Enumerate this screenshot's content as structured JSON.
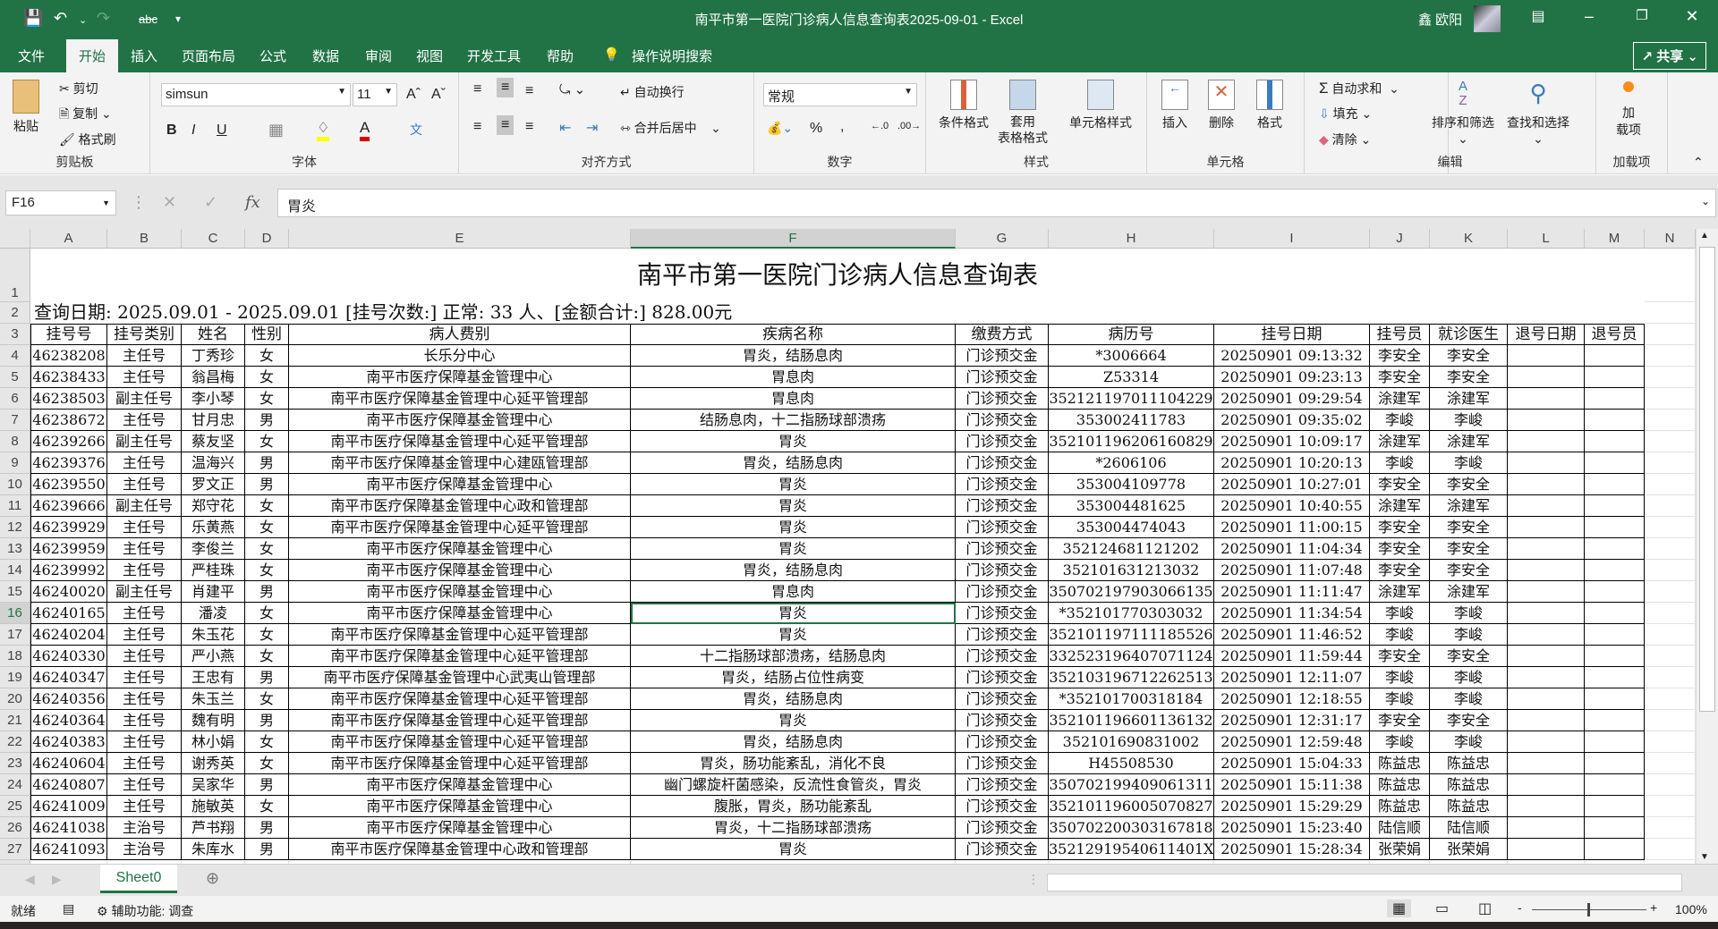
{
  "window": {
    "title": "南平市第一医院门诊病人信息查询表2025-09-01  -  Excel",
    "user": "鑫 欧阳"
  },
  "tabs": [
    "文件",
    "开始",
    "插入",
    "页面布局",
    "公式",
    "数据",
    "审阅",
    "视图",
    "开发工具",
    "帮助"
  ],
  "active_tab": "开始",
  "tell_me": "操作说明搜索",
  "share_label": "共享",
  "ribbon": {
    "clipboard": {
      "label": "剪贴板",
      "paste": "粘贴",
      "cut": "剪切",
      "copy": "复制",
      "format_painter": "格式刷"
    },
    "font": {
      "label": "字体",
      "font_name": "simsun",
      "font_size": "11",
      "bold": "B",
      "italic": "I",
      "underline": "U",
      "highlight_color": "#ffff00",
      "font_color": "#e00000"
    },
    "alignment": {
      "label": "对齐方式",
      "wrap": "自动换行",
      "merge": "合并后居中"
    },
    "number": {
      "label": "数字",
      "format": "常规",
      "percent": "%",
      "comma": ","
    },
    "styles": {
      "label": "样式",
      "conditional": "条件格式",
      "table_l1": "套用",
      "table_l2": "表格格式",
      "cell_styles": "单元格样式"
    },
    "cells": {
      "label": "单元格",
      "insert": "插入",
      "delete": "删除",
      "format": "格式"
    },
    "editing": {
      "label": "编辑",
      "autosum": "自动求和",
      "fill": "填充",
      "clear": "清除",
      "sort": "排序和筛选",
      "find": "查找和选择"
    },
    "addins": {
      "label": "加载项",
      "btn_l1": "加",
      "btn_l2": "载项"
    }
  },
  "formula_bar": {
    "name_box": "F16",
    "fx": "fx",
    "value": "胃炎"
  },
  "columns": [
    "A",
    "B",
    "C",
    "D",
    "E",
    "F",
    "G",
    "H",
    "I",
    "J",
    "K",
    "L",
    "M",
    "N"
  ],
  "selected_column": "F",
  "selected_row": "16",
  "sheet": {
    "title": "南平市第一医院门诊病人信息查询表",
    "summary": "查询日期: 2025.09.01 - 2025.09.01  [挂号次数:] 正常: 33 人、[金额合计:] 828.00元",
    "headers": [
      "挂号号",
      "挂号类别",
      "姓名",
      "性别",
      "病人费别",
      "疾病名称",
      "缴费方式",
      "病历号",
      "挂号日期",
      "挂号员",
      "就诊医生",
      "退号日期",
      "退号员"
    ],
    "rows": [
      [
        "46238208",
        "主任号",
        "丁秀珍",
        "女",
        "长乐分中心",
        "胃炎，结肠息肉",
        "门诊预交金",
        "*3006664",
        "20250901  09:13:32",
        "李安全",
        "李安全",
        "",
        ""
      ],
      [
        "46238433",
        "主任号",
        "翁昌梅",
        "女",
        "南平市医疗保障基金管理中心",
        "胃息肉",
        "门诊预交金",
        "Z53314",
        "20250901  09:23:13",
        "李安全",
        "李安全",
        "",
        ""
      ],
      [
        "46238503",
        "副主任号",
        "李小琴",
        "女",
        "南平市医疗保障基金管理中心延平管理部",
        "胃息肉",
        "门诊预交金",
        "352121197011104229",
        "20250901  09:29:54",
        "涂建军",
        "涂建军",
        "",
        ""
      ],
      [
        "46238672",
        "主任号",
        "甘月忠",
        "男",
        "南平市医疗保障基金管理中心",
        "结肠息肉，十二指肠球部溃疡",
        "门诊预交金",
        "353002411783",
        "20250901  09:35:02",
        "李峻",
        "李峻",
        "",
        ""
      ],
      [
        "46239266",
        "副主任号",
        "蔡友坚",
        "女",
        "南平市医疗保障基金管理中心延平管理部",
        "胃炎",
        "门诊预交金",
        "352101196206160829",
        "20250901  10:09:17",
        "涂建军",
        "涂建军",
        "",
        ""
      ],
      [
        "46239376",
        "主任号",
        "温海兴",
        "男",
        "南平市医疗保障基金管理中心建瓯管理部",
        "胃炎，结肠息肉",
        "门诊预交金",
        "*2606106",
        "20250901  10:20:13",
        "李峻",
        "李峻",
        "",
        ""
      ],
      [
        "46239550",
        "主任号",
        "罗文正",
        "男",
        "南平市医疗保障基金管理中心",
        "胃炎",
        "门诊预交金",
        "353004109778",
        "20250901  10:27:01",
        "李安全",
        "李安全",
        "",
        ""
      ],
      [
        "46239666",
        "副主任号",
        "郑守花",
        "女",
        "南平市医疗保障基金管理中心政和管理部",
        "胃炎",
        "门诊预交金",
        "353004481625",
        "20250901  10:40:55",
        "涂建军",
        "涂建军",
        "",
        ""
      ],
      [
        "46239929",
        "主任号",
        "乐黄燕",
        "女",
        "南平市医疗保障基金管理中心延平管理部",
        "胃炎",
        "门诊预交金",
        "353004474043",
        "20250901  11:00:15",
        "李安全",
        "李安全",
        "",
        ""
      ],
      [
        "46239959",
        "主任号",
        "李俊兰",
        "女",
        "南平市医疗保障基金管理中心",
        "胃炎",
        "门诊预交金",
        "352124681121202",
        "20250901  11:04:34",
        "李安全",
        "李安全",
        "",
        ""
      ],
      [
        "46239992",
        "主任号",
        "严桂珠",
        "女",
        "南平市医疗保障基金管理中心",
        "胃炎，结肠息肉",
        "门诊预交金",
        "352101631213032",
        "20250901  11:07:48",
        "李安全",
        "李安全",
        "",
        ""
      ],
      [
        "46240020",
        "副主任号",
        "肖建平",
        "男",
        "南平市医疗保障基金管理中心",
        "胃息肉",
        "门诊预交金",
        "350702197903066135",
        "20250901  11:11:47",
        "涂建军",
        "涂建军",
        "",
        ""
      ],
      [
        "46240165",
        "主任号",
        "潘凌",
        "女",
        "南平市医疗保障基金管理中心",
        "胃炎",
        "门诊预交金",
        "*352101770303032",
        "20250901  11:34:54",
        "李峻",
        "李峻",
        "",
        ""
      ],
      [
        "46240204",
        "主任号",
        "朱玉花",
        "女",
        "南平市医疗保障基金管理中心延平管理部",
        "胃炎",
        "门诊预交金",
        "352101197111185526",
        "20250901  11:46:52",
        "李峻",
        "李峻",
        "",
        ""
      ],
      [
        "46240330",
        "主任号",
        "严小燕",
        "女",
        "南平市医疗保障基金管理中心延平管理部",
        "十二指肠球部溃疡，结肠息肉",
        "门诊预交金",
        "332523196407071124",
        "20250901  11:59:44",
        "李安全",
        "李安全",
        "",
        ""
      ],
      [
        "46240347",
        "主任号",
        "王忠有",
        "男",
        "南平市医疗保障基金管理中心武夷山管理部",
        "胃炎，结肠占位性病变",
        "门诊预交金",
        "352103196712262513",
        "20250901  12:11:07",
        "李峻",
        "李峻",
        "",
        ""
      ],
      [
        "46240356",
        "主任号",
        "朱玉兰",
        "女",
        "南平市医疗保障基金管理中心延平管理部",
        "胃炎，结肠息肉",
        "门诊预交金",
        "*352101700318184",
        "20250901  12:18:55",
        "李峻",
        "李峻",
        "",
        ""
      ],
      [
        "46240364",
        "主任号",
        "魏有明",
        "男",
        "南平市医疗保障基金管理中心延平管理部",
        "胃炎",
        "门诊预交金",
        "352101196601136132",
        "20250901  12:31:17",
        "李安全",
        "李安全",
        "",
        ""
      ],
      [
        "46240383",
        "主任号",
        "林小娟",
        "女",
        "南平市医疗保障基金管理中心延平管理部",
        "胃炎，结肠息肉",
        "门诊预交金",
        "352101690831002",
        "20250901  12:59:48",
        "李峻",
        "李峻",
        "",
        ""
      ],
      [
        "46240604",
        "主任号",
        "谢秀英",
        "女",
        "南平市医疗保障基金管理中心延平管理部",
        "胃炎，肠功能紊乱，消化不良",
        "门诊预交金",
        "H45508530",
        "20250901  15:04:33",
        "陈益忠",
        "陈益忠",
        "",
        ""
      ],
      [
        "46240807",
        "主任号",
        "吴家华",
        "男",
        "南平市医疗保障基金管理中心",
        "幽门螺旋杆菌感染，反流性食管炎，胃炎",
        "门诊预交金",
        "350702199409061311",
        "20250901  15:11:38",
        "陈益忠",
        "陈益忠",
        "",
        ""
      ],
      [
        "46241009",
        "主任号",
        "施敏英",
        "女",
        "南平市医疗保障基金管理中心",
        "腹胀，胃炎，肠功能紊乱",
        "门诊预交金",
        "352101196005070827",
        "20250901  15:29:29",
        "陈益忠",
        "陈益忠",
        "",
        ""
      ],
      [
        "46241038",
        "主治号",
        "芦书翔",
        "男",
        "南平市医疗保障基金管理中心",
        "胃炎，十二指肠球部溃疡",
        "门诊预交金",
        "350702200303167818",
        "20250901  15:23:40",
        "陆信顺",
        "陆信顺",
        "",
        ""
      ],
      [
        "46241093",
        "主治号",
        "朱库水",
        "男",
        "南平市医疗保障基金管理中心政和管理部",
        "胃炎",
        "门诊预交金",
        "35212919540611401X",
        "20250901  15:28:34",
        "张荣娟",
        "张荣娟",
        "",
        ""
      ]
    ]
  },
  "sheet_tabs": [
    "Sheet0"
  ],
  "status": {
    "ready": "就绪",
    "accessibility": "辅助功能: 调查",
    "zoom": "100%"
  }
}
